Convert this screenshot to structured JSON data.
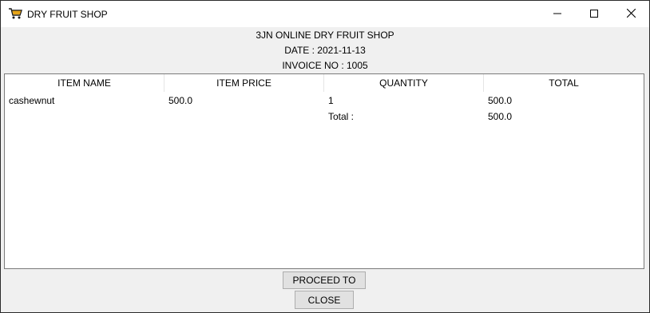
{
  "window": {
    "title": "DRY FRUIT SHOP",
    "app_icon": "shopping-cart-icon",
    "controls": [
      "minimize-icon",
      "maximize-icon",
      "close-icon"
    ]
  },
  "header": {
    "shop_name": "3JN ONLINE DRY FRUIT SHOP",
    "date_line": "DATE : 2021-11-13",
    "invoice_line": "INVOICE NO : 1005"
  },
  "table": {
    "columns": [
      "ITEM NAME",
      "ITEM PRICE",
      "QUANTITY",
      "TOTAL"
    ],
    "rows": [
      [
        "cashewnut",
        "500.0",
        "1",
        "500.0"
      ],
      [
        "",
        "",
        "Total :",
        "500.0"
      ]
    ]
  },
  "buttons": {
    "proceed_label": "PROCEED TO PAY",
    "close_label": "CLOSE"
  },
  "colors": {
    "background": "#f0f0f0",
    "titlebar": "#ffffff",
    "table_bg": "#ffffff",
    "button_bg": "#e1e1e1",
    "cart_icon": "#e6a417"
  }
}
